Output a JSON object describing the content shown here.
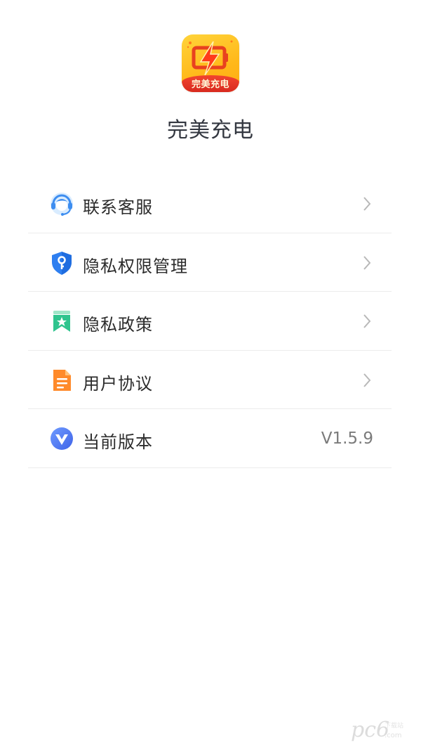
{
  "app": {
    "name": "完美充电",
    "logo_text": "完美充电"
  },
  "menu": [
    {
      "id": "contact",
      "label": "联系客服",
      "icon": "headset-icon",
      "chevron": true
    },
    {
      "id": "permissions",
      "label": "隐私权限管理",
      "icon": "shield-key-icon",
      "chevron": true
    },
    {
      "id": "privacy",
      "label": "隐私政策",
      "icon": "bookmark-star-icon",
      "chevron": true
    },
    {
      "id": "agreement",
      "label": "用户协议",
      "icon": "document-icon",
      "chevron": true
    },
    {
      "id": "version",
      "label": "当前版本",
      "icon": "v-logo-icon",
      "value": "V1.5.9"
    }
  ],
  "watermark": {
    "main": "pc6",
    "sub": "下载站",
    "url": ".com"
  },
  "colors": {
    "accent_blue": "#3d8df0",
    "green": "#2fc48e",
    "orange": "#ff8a2a",
    "logo_yellow": "#ffc92a",
    "logo_red": "#e23a25"
  }
}
